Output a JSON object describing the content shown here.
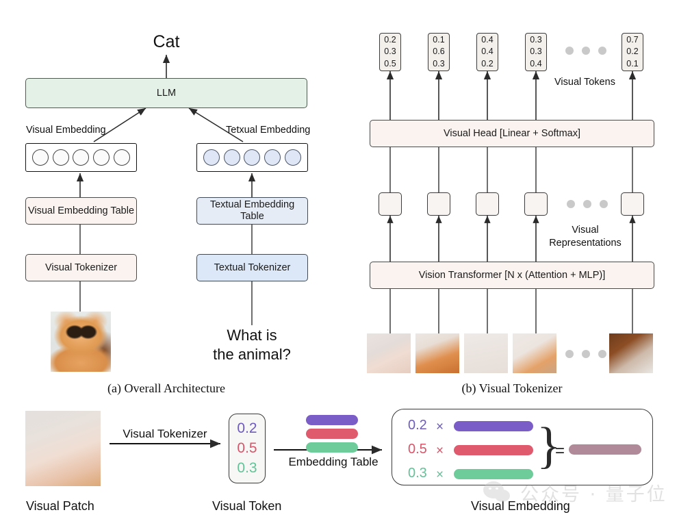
{
  "figure": {
    "captions": {
      "panel_a": "(a) Overall Architecture",
      "panel_b": "(b) Visual Tokenizer"
    },
    "watermark": "公众号 · 量子位"
  },
  "panel_a": {
    "output_text": "Cat",
    "llm_label": "LLM",
    "visual_embedding_label": "Visual Embedding",
    "textual_embedding_label": "Tetxual Embedding",
    "visual_embedding_table": "Visual Embedding Table",
    "textual_embedding_table": "Textual Embedding Table",
    "visual_tokenizer": "Visual Tokenizer",
    "textual_tokenizer": "Textual Tokenizer",
    "question_text": "What is\nthe animal?",
    "visual_embedding_slots": 5,
    "textual_embedding_slots": 5
  },
  "panel_b": {
    "visual_tokens_label": "Visual Tokens",
    "visual_head_label": "Visual Head [Linear + Softmax]",
    "visual_representations_label": "Visual\nRepresentations",
    "vision_transformer_label": "Vision Transformer [N x (Attention + MLP)]",
    "tokens": [
      {
        "values": [
          "0.2",
          "0.3",
          "0.5"
        ]
      },
      {
        "values": [
          "0.1",
          "0.6",
          "0.3"
        ]
      },
      {
        "values": [
          "0.4",
          "0.4",
          "0.2"
        ]
      },
      {
        "values": [
          "0.3",
          "0.3",
          "0.4"
        ]
      },
      {
        "values": [
          "0.7",
          "0.2",
          "0.1"
        ]
      }
    ],
    "ellipsis": "• • •"
  },
  "panel_c": {
    "visual_patch_label": "Visual Patch",
    "visual_tokenizer_arrow_label": "Visual Tokenizer",
    "visual_token_label": "Visual Token",
    "embedding_table_arrow_label": "Embedding Table",
    "visual_embedding_label": "Visual Embedding",
    "token_values": [
      "0.2",
      "0.5",
      "0.3"
    ],
    "equation": {
      "rows": [
        {
          "coeff": "0.2",
          "times": "×",
          "color": "#7b5dc7"
        },
        {
          "coeff": "0.5",
          "times": "×",
          "color": "#e05a6e"
        },
        {
          "coeff": "0.3",
          "times": "×",
          "color": "#6ecb9a"
        }
      ],
      "equals": "=",
      "result_color": "#b08a98"
    }
  },
  "colors": {
    "visual_fill": "#faf3ef",
    "textual_fill": "#dce8f7",
    "llm_fill": "#e4f1e7",
    "purple": "#7b5dc7",
    "red": "#e05a6e",
    "green": "#6ecb9a",
    "result": "#b08a98"
  }
}
